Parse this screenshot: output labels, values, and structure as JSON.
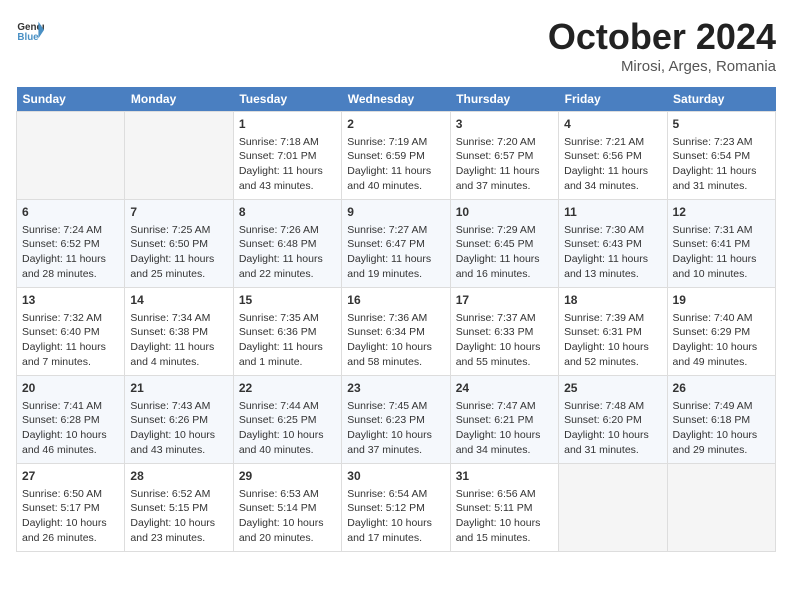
{
  "header": {
    "logo_line1": "General",
    "logo_line2": "Blue",
    "month": "October 2024",
    "location": "Mirosi, Arges, Romania"
  },
  "days_of_week": [
    "Sunday",
    "Monday",
    "Tuesday",
    "Wednesday",
    "Thursday",
    "Friday",
    "Saturday"
  ],
  "weeks": [
    [
      {
        "day": "",
        "info": ""
      },
      {
        "day": "",
        "info": ""
      },
      {
        "day": "1",
        "info": "Sunrise: 7:18 AM\nSunset: 7:01 PM\nDaylight: 11 hours and 43 minutes."
      },
      {
        "day": "2",
        "info": "Sunrise: 7:19 AM\nSunset: 6:59 PM\nDaylight: 11 hours and 40 minutes."
      },
      {
        "day": "3",
        "info": "Sunrise: 7:20 AM\nSunset: 6:57 PM\nDaylight: 11 hours and 37 minutes."
      },
      {
        "day": "4",
        "info": "Sunrise: 7:21 AM\nSunset: 6:56 PM\nDaylight: 11 hours and 34 minutes."
      },
      {
        "day": "5",
        "info": "Sunrise: 7:23 AM\nSunset: 6:54 PM\nDaylight: 11 hours and 31 minutes."
      }
    ],
    [
      {
        "day": "6",
        "info": "Sunrise: 7:24 AM\nSunset: 6:52 PM\nDaylight: 11 hours and 28 minutes."
      },
      {
        "day": "7",
        "info": "Sunrise: 7:25 AM\nSunset: 6:50 PM\nDaylight: 11 hours and 25 minutes."
      },
      {
        "day": "8",
        "info": "Sunrise: 7:26 AM\nSunset: 6:48 PM\nDaylight: 11 hours and 22 minutes."
      },
      {
        "day": "9",
        "info": "Sunrise: 7:27 AM\nSunset: 6:47 PM\nDaylight: 11 hours and 19 minutes."
      },
      {
        "day": "10",
        "info": "Sunrise: 7:29 AM\nSunset: 6:45 PM\nDaylight: 11 hours and 16 minutes."
      },
      {
        "day": "11",
        "info": "Sunrise: 7:30 AM\nSunset: 6:43 PM\nDaylight: 11 hours and 13 minutes."
      },
      {
        "day": "12",
        "info": "Sunrise: 7:31 AM\nSunset: 6:41 PM\nDaylight: 11 hours and 10 minutes."
      }
    ],
    [
      {
        "day": "13",
        "info": "Sunrise: 7:32 AM\nSunset: 6:40 PM\nDaylight: 11 hours and 7 minutes."
      },
      {
        "day": "14",
        "info": "Sunrise: 7:34 AM\nSunset: 6:38 PM\nDaylight: 11 hours and 4 minutes."
      },
      {
        "day": "15",
        "info": "Sunrise: 7:35 AM\nSunset: 6:36 PM\nDaylight: 11 hours and 1 minute."
      },
      {
        "day": "16",
        "info": "Sunrise: 7:36 AM\nSunset: 6:34 PM\nDaylight: 10 hours and 58 minutes."
      },
      {
        "day": "17",
        "info": "Sunrise: 7:37 AM\nSunset: 6:33 PM\nDaylight: 10 hours and 55 minutes."
      },
      {
        "day": "18",
        "info": "Sunrise: 7:39 AM\nSunset: 6:31 PM\nDaylight: 10 hours and 52 minutes."
      },
      {
        "day": "19",
        "info": "Sunrise: 7:40 AM\nSunset: 6:29 PM\nDaylight: 10 hours and 49 minutes."
      }
    ],
    [
      {
        "day": "20",
        "info": "Sunrise: 7:41 AM\nSunset: 6:28 PM\nDaylight: 10 hours and 46 minutes."
      },
      {
        "day": "21",
        "info": "Sunrise: 7:43 AM\nSunset: 6:26 PM\nDaylight: 10 hours and 43 minutes."
      },
      {
        "day": "22",
        "info": "Sunrise: 7:44 AM\nSunset: 6:25 PM\nDaylight: 10 hours and 40 minutes."
      },
      {
        "day": "23",
        "info": "Sunrise: 7:45 AM\nSunset: 6:23 PM\nDaylight: 10 hours and 37 minutes."
      },
      {
        "day": "24",
        "info": "Sunrise: 7:47 AM\nSunset: 6:21 PM\nDaylight: 10 hours and 34 minutes."
      },
      {
        "day": "25",
        "info": "Sunrise: 7:48 AM\nSunset: 6:20 PM\nDaylight: 10 hours and 31 minutes."
      },
      {
        "day": "26",
        "info": "Sunrise: 7:49 AM\nSunset: 6:18 PM\nDaylight: 10 hours and 29 minutes."
      }
    ],
    [
      {
        "day": "27",
        "info": "Sunrise: 6:50 AM\nSunset: 5:17 PM\nDaylight: 10 hours and 26 minutes."
      },
      {
        "day": "28",
        "info": "Sunrise: 6:52 AM\nSunset: 5:15 PM\nDaylight: 10 hours and 23 minutes."
      },
      {
        "day": "29",
        "info": "Sunrise: 6:53 AM\nSunset: 5:14 PM\nDaylight: 10 hours and 20 minutes."
      },
      {
        "day": "30",
        "info": "Sunrise: 6:54 AM\nSunset: 5:12 PM\nDaylight: 10 hours and 17 minutes."
      },
      {
        "day": "31",
        "info": "Sunrise: 6:56 AM\nSunset: 5:11 PM\nDaylight: 10 hours and 15 minutes."
      },
      {
        "day": "",
        "info": ""
      },
      {
        "day": "",
        "info": ""
      }
    ]
  ]
}
